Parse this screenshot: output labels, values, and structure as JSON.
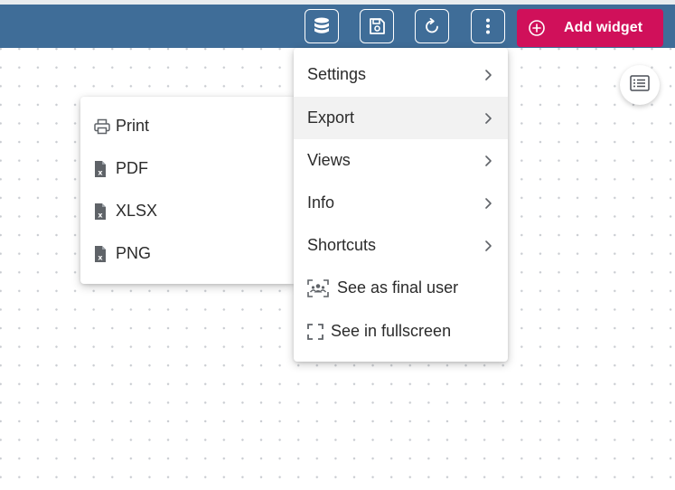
{
  "toolbar": {
    "buttons": [
      {
        "icon": "database-icon"
      },
      {
        "icon": "save-icon"
      },
      {
        "icon": "refresh-icon"
      },
      {
        "icon": "more-vertical-icon"
      }
    ],
    "add_widget_label": "Add widget",
    "accent_color": "#d0105a",
    "bar_color": "#3f6d98"
  },
  "main_menu": {
    "items": [
      {
        "label": "Settings",
        "has_submenu": true
      },
      {
        "label": "Export",
        "has_submenu": true,
        "active": true
      },
      {
        "label": "Views",
        "has_submenu": true
      },
      {
        "label": "Info",
        "has_submenu": true
      },
      {
        "label": "Shortcuts",
        "has_submenu": true
      },
      {
        "label": "See as final user",
        "icon": "users-scan-icon"
      },
      {
        "label": "See in fullscreen",
        "icon": "fullscreen-icon"
      }
    ]
  },
  "export_menu": {
    "items": [
      {
        "label": "Print",
        "icon": "printer-icon"
      },
      {
        "label": "PDF",
        "icon": "file-x-icon"
      },
      {
        "label": "XLSX",
        "icon": "file-x-icon"
      },
      {
        "label": "PNG",
        "icon": "file-x-icon"
      }
    ]
  },
  "side_button": {
    "icon": "list-icon"
  }
}
